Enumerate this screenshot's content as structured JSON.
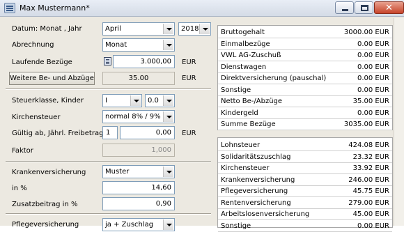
{
  "window": {
    "title": "Max Mustermann*"
  },
  "form": {
    "datum_label": "Datum: Monat , Jahr",
    "monat_value": "April",
    "jahr_value": "2018",
    "abrechnung_label": "Abrechnung",
    "abrechnung_value": "Monat",
    "laufende_label": "Laufende Bezüge",
    "laufende_value": "3.000,00",
    "laufende_unit": "EUR",
    "weitere_button": "Weitere Be- und Abzüge",
    "weitere_value": "35.00",
    "weitere_unit": "EUR",
    "steuerklasse_label": "Steuerklasse, Kinder",
    "steuerklasse_value": "I",
    "kinder_value": "0.0",
    "kirchensteuer_label": "Kirchensteuer",
    "kirchensteuer_value": "normal 8% / 9%",
    "gueltig_label": "Gültig ab, Jährl. Freibetrag",
    "gueltig_value": "1",
    "freibetrag_value": "0,00",
    "freibetrag_unit": "EUR",
    "faktor_label": "Faktor",
    "faktor_value": "1,000",
    "kv_label": "Krankenversicherung",
    "kv_value": "Muster",
    "kv_in_label": "in %",
    "kv_in_value": "14,60",
    "zusatz_label": "Zusatzbeitrag in %",
    "zusatz_value": "0,90",
    "pflege_label": "Pflegeversicherung",
    "pflege_value": "ja + Zuschlag"
  },
  "summary1": [
    {
      "label": "Bruttogehalt",
      "value": "3000.00 EUR"
    },
    {
      "label": "Einmalbezüge",
      "value": "0.00 EUR"
    },
    {
      "label": "VWL AG-Zuschuß",
      "value": "0.00 EUR"
    },
    {
      "label": "Dienstwagen",
      "value": "0.00 EUR"
    },
    {
      "label": "Direktversicherung (pauschal)",
      "value": "0.00 EUR"
    },
    {
      "label": "Sonstige",
      "value": "0.00 EUR"
    },
    {
      "label": "Netto Be-/Abzüge",
      "value": "35.00 EUR"
    },
    {
      "label": "Kindergeld",
      "value": "0.00 EUR"
    },
    {
      "label": "Summe Bezüge",
      "value": "3035.00 EUR"
    }
  ],
  "summary2": [
    {
      "label": "Lohnsteuer",
      "value": "424.08 EUR"
    },
    {
      "label": "Solidaritätszuschlag",
      "value": "23.32 EUR"
    },
    {
      "label": "Kirchensteuer",
      "value": "33.92 EUR"
    },
    {
      "label": "Krankenversicherung",
      "value": "246.00 EUR"
    },
    {
      "label": "Pflegeversicherung",
      "value": "45.75 EUR"
    },
    {
      "label": "Rentenversicherung",
      "value": "279.00 EUR"
    },
    {
      "label": "Arbeitslosenversicherung",
      "value": "45.00 EUR"
    },
    {
      "label": "Sonstige",
      "value": "0.00 EUR"
    }
  ]
}
